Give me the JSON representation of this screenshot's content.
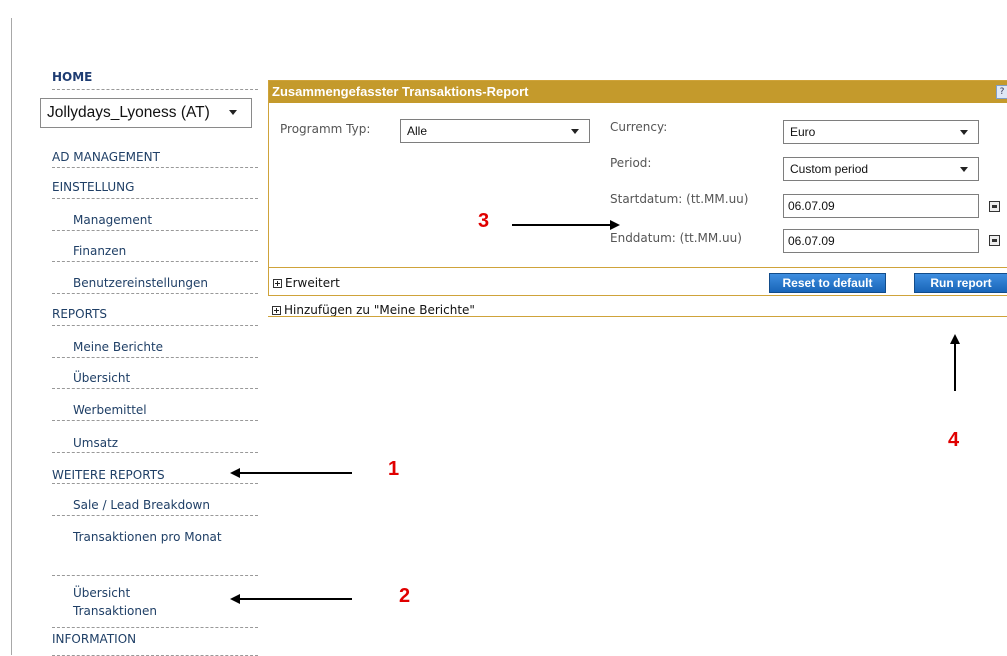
{
  "nav": {
    "home": "HOME",
    "account_select": "Jollydays_Lyoness (AT)",
    "items": [
      {
        "label": "AD MANAGEMENT",
        "sub": false
      },
      {
        "label": "EINSTELLUNG",
        "sub": false
      },
      {
        "label": "Management",
        "sub": true
      },
      {
        "label": "Finanzen",
        "sub": true
      },
      {
        "label": "Benutzereinstellungen",
        "sub": true
      },
      {
        "label": "REPORTS",
        "sub": false
      },
      {
        "label": "Meine Berichte",
        "sub": true
      },
      {
        "label": "Übersicht",
        "sub": true
      },
      {
        "label": "Werbemittel",
        "sub": true
      },
      {
        "label": "Umsatz",
        "sub": true
      },
      {
        "label": "WEITERE REPORTS",
        "sub": false
      },
      {
        "label": "Sale / Lead Breakdown",
        "sub": true
      },
      {
        "label": "Transaktionen pro Monat",
        "sub": true
      },
      {
        "label": "Übersicht Transaktionen",
        "sub": true
      },
      {
        "label": "INFORMATION",
        "sub": false
      }
    ]
  },
  "report": {
    "title": "Zusammengefasster Transaktions-Report",
    "programm_typ_label": "Programm Typ:",
    "programm_typ_value": "Alle",
    "currency_label": "Currency:",
    "currency_value": "Euro",
    "period_label": "Period:",
    "period_value": "Custom period",
    "start_label": "Startdatum: (tt.MM.uu)",
    "start_value": "06.07.09",
    "end_label": "Enddatum: (tt.MM.uu)",
    "end_value": "06.07.09",
    "erweitert": "Erweitert",
    "reset_button": "Reset to default",
    "run_button": "Run report",
    "hinzufuegen": "Hinzufügen zu \"Meine Berichte\""
  },
  "annotations": {
    "n1": "1",
    "n2": "2",
    "n3": "3",
    "n4": "4",
    "color": "#e00000"
  },
  "colors": {
    "panel_header": "#c49a2c",
    "button": "#1e6fc5",
    "nav_text": "#1f3f66"
  }
}
